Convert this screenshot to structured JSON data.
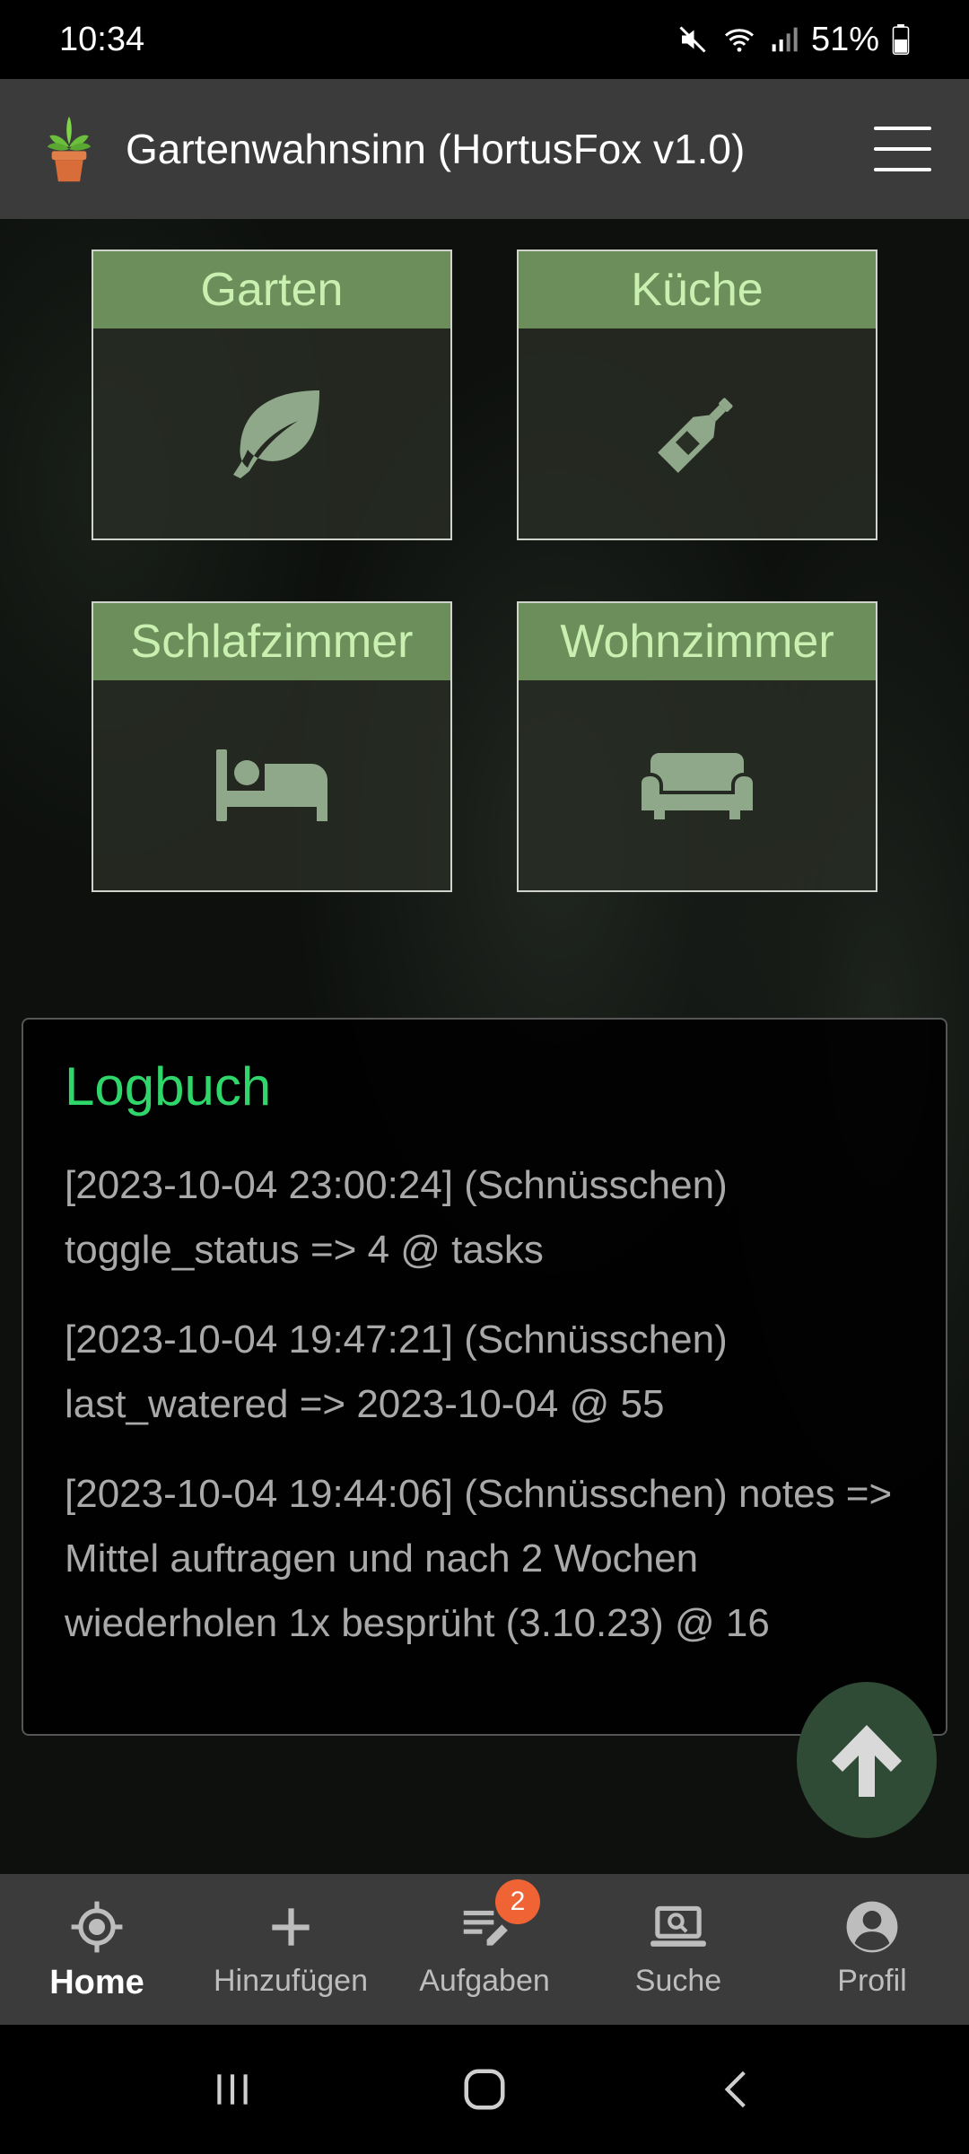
{
  "status_bar": {
    "time": "10:34",
    "battery": "51%",
    "icons": [
      "mute-icon",
      "wifi-icon",
      "signal-icon",
      "battery-icon"
    ]
  },
  "header": {
    "logo_icon": "plant-pot-icon",
    "title": "Gartenwahnsinn (HortusFox v1.0)",
    "menu_icon": "hamburger-menu-icon"
  },
  "rooms": [
    {
      "name": "Garten",
      "icon": "leaf-icon"
    },
    {
      "name": "Küche",
      "icon": "bottle-icon"
    },
    {
      "name": "Schlafzimmer",
      "icon": "bed-icon"
    },
    {
      "name": "Wohnzimmer",
      "icon": "sofa-icon"
    }
  ],
  "logbook": {
    "title": "Logbuch",
    "entries": [
      "[2023-10-04 23:00:24] (Schnüsschen) toggle_status => 4 @ tasks",
      "[2023-10-04 19:47:21] (Schnüsschen) last_watered => 2023-10-04 @ 55",
      "[2023-10-04 19:44:06] (Schnüsschen) notes => Mittel auftragen und nach 2 Wochen wiederholen 1x besprüht (3.10.23) @ 16"
    ]
  },
  "fab": {
    "icon": "arrow-up-icon"
  },
  "bottom_nav": {
    "items": [
      {
        "label": "Home",
        "icon": "crosshair-icon",
        "active": true
      },
      {
        "label": "Hinzufügen",
        "icon": "plus-icon"
      },
      {
        "label": "Aufgaben",
        "icon": "tasks-edit-icon",
        "badge": "2"
      },
      {
        "label": "Suche",
        "icon": "laptop-search-icon"
      },
      {
        "label": "Profil",
        "icon": "profile-icon"
      }
    ]
  },
  "colors": {
    "accent_green": "#2fd66a",
    "tile_header": "#6b8e5a",
    "tile_text": "#c9f0b0",
    "badge": "#f06335",
    "bar_bg": "#3b3b3b"
  }
}
